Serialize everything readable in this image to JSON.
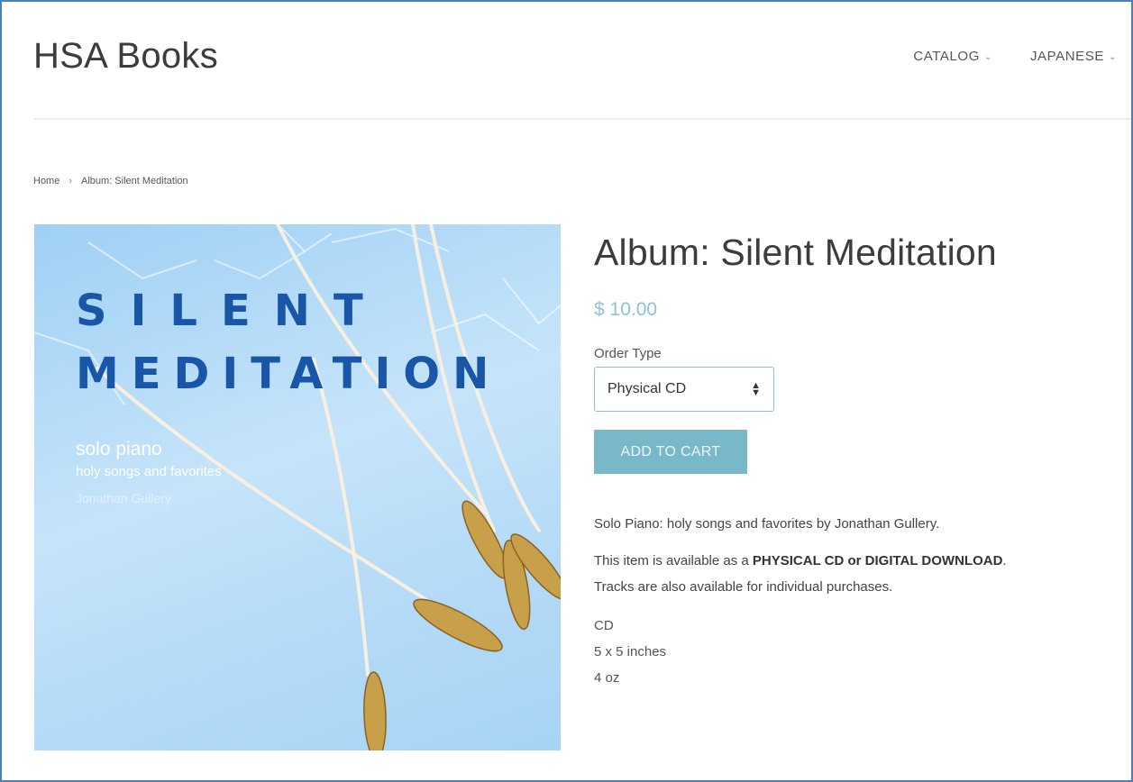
{
  "site": {
    "logo": "HSA Books"
  },
  "nav": {
    "items": [
      {
        "label": "CATALOG"
      },
      {
        "label": "JAPANESE"
      }
    ]
  },
  "breadcrumb": {
    "home": "Home",
    "current": "Album: Silent Meditation"
  },
  "album_art": {
    "title_line1": "SILENT",
    "title_line2": "MEDITATION",
    "subtitle1": "solo piano",
    "subtitle2": "holy songs and favorites",
    "artist": "Jonathan Gullery"
  },
  "product": {
    "title": "Album: Silent Meditation",
    "price": "$ 10.00",
    "order_type_label": "Order Type",
    "order_type_value": "Physical CD",
    "add_to_cart": "ADD TO CART",
    "description1": "Solo Piano: holy songs and favorites by Jonathan Gullery.",
    "description2_pre": "This item is available as a ",
    "description2_bold": "PHYSICAL CD or DIGITAL DOWNLOAD",
    "description2_post": ".",
    "description3": "Tracks are also available for individual purchases.",
    "spec_format": "CD",
    "spec_size": "5 x 5 inches",
    "spec_weight": "4 oz"
  },
  "colors": {
    "price": "#8fc3d3",
    "button": "#78b8c8",
    "art_title": "#1a56a8",
    "border": "#4a7fc1"
  }
}
